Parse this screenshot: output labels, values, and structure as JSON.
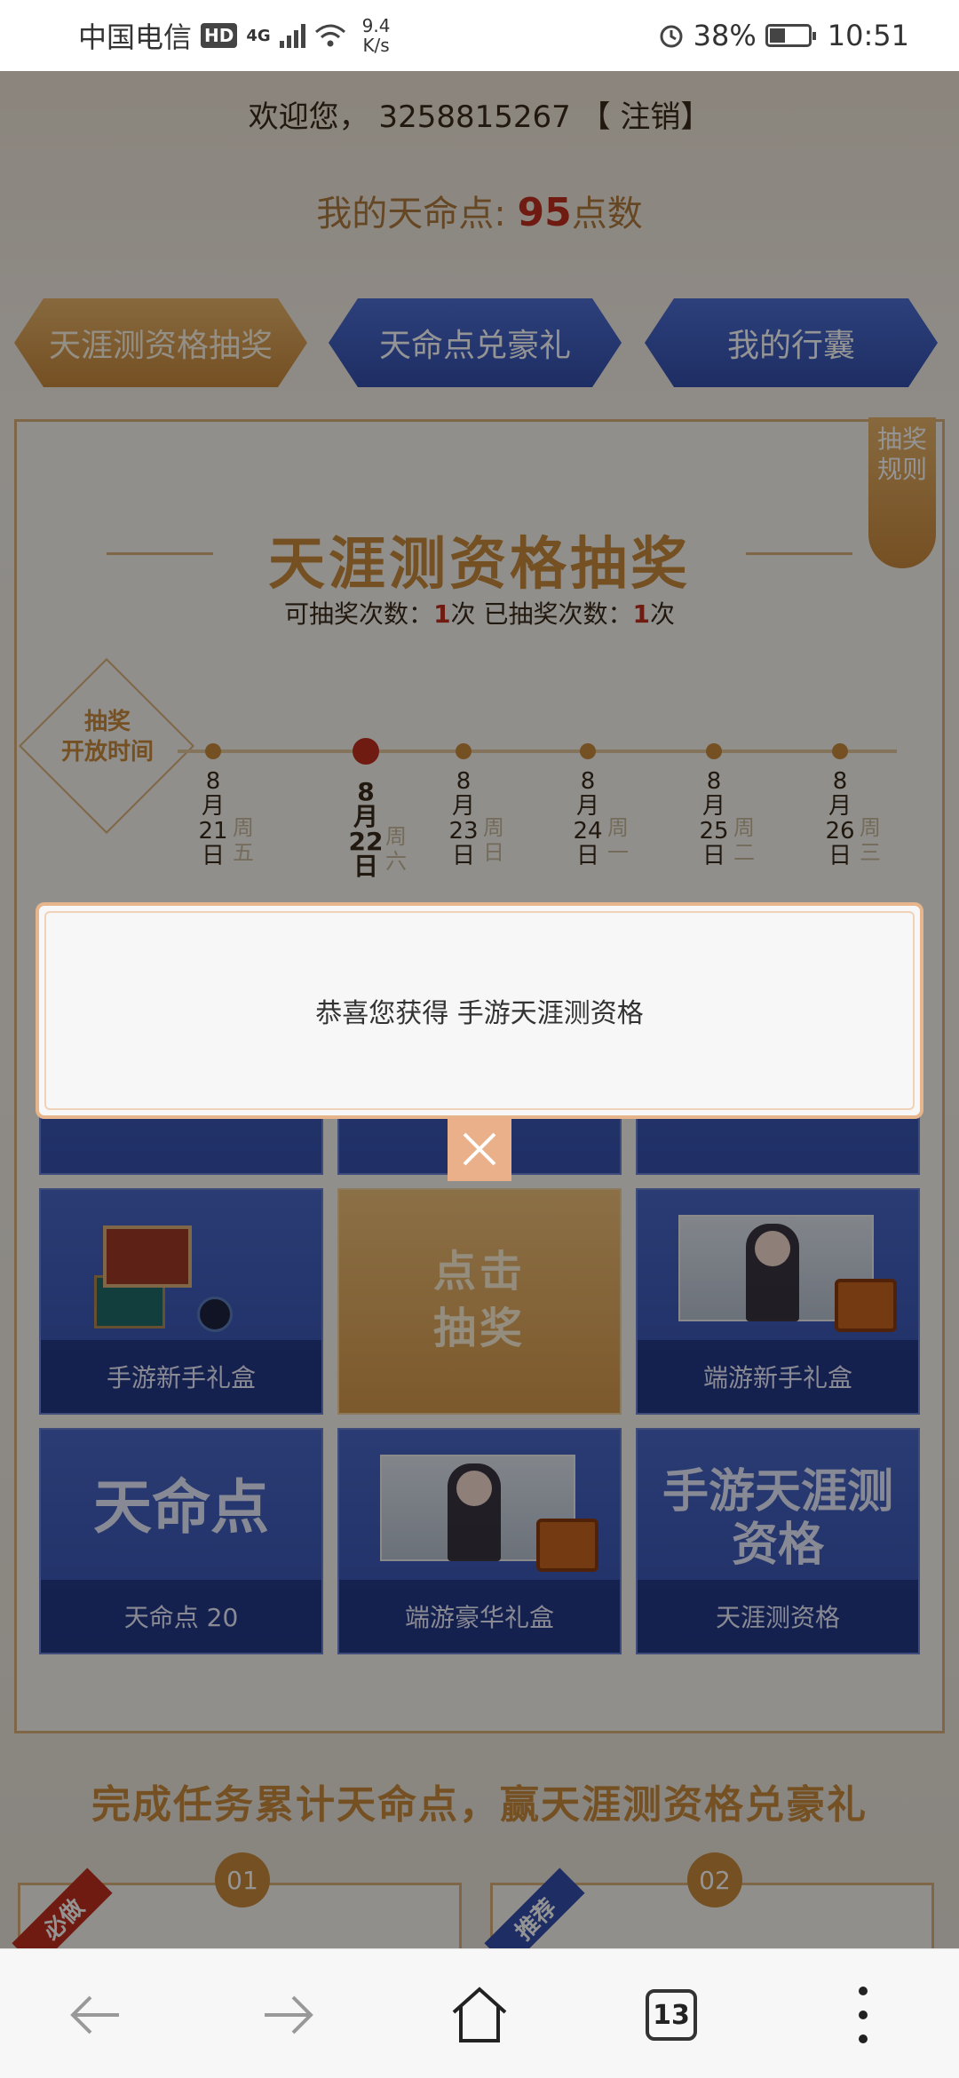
{
  "status_bar": {
    "carrier": "中国电信",
    "hd": "HD",
    "signal": "4G",
    "net_speed_value": "9.4",
    "net_speed_unit": "K/s",
    "battery": "38%",
    "time": "10:51"
  },
  "header": {
    "welcome": "欢迎您， 3258815267 【 注销】",
    "points_prefix": "我的天命点: ",
    "points_value": "95",
    "points_suffix": "点数"
  },
  "tabs": [
    {
      "label": "天涯测资格抽奖"
    },
    {
      "label": "天命点兑豪礼"
    },
    {
      "label": "我的行囊"
    }
  ],
  "rules_label": "抽奖规则",
  "lottery": {
    "title": "天涯测资格抽奖",
    "remaining_label": "可抽奖次数：",
    "remaining_value": "1",
    "remaining_unit": "次 已抽奖次数：",
    "used_value": "1",
    "used_unit": "次",
    "open_time_label_1": "抽奖",
    "open_time_label_2": "开放时间",
    "dates": [
      {
        "month": "8",
        "m": "月",
        "day": "21",
        "d": "日",
        "weekday": "周五"
      },
      {
        "month": "8",
        "m": "月",
        "day": "22",
        "d": "日",
        "weekday": "周六"
      },
      {
        "month": "8",
        "m": "月",
        "day": "23",
        "d": "日",
        "weekday": "周日"
      },
      {
        "month": "8",
        "m": "月",
        "day": "24",
        "d": "日",
        "weekday": "周一"
      },
      {
        "month": "8",
        "m": "月",
        "day": "25",
        "d": "日",
        "weekday": "周二"
      },
      {
        "month": "8",
        "m": "月",
        "day": "26",
        "d": "日",
        "weekday": "周三"
      }
    ]
  },
  "prizes": {
    "gift_box_mobile": "手游新手礼盒",
    "draw_line1": "点击",
    "draw_line2": "抽奖",
    "gift_box_pc": "端游新手礼盒",
    "tianming_big": "天命点",
    "tianming_caption": "天命点 20",
    "luxury_box": "端游豪华礼盒",
    "qual_big_1": "手游天涯测",
    "qual_big_2": "资格",
    "qual_caption": "天涯测资格"
  },
  "tasks": {
    "title": "完成任务累计天命点，赢天涯测资格兑豪礼",
    "step1": "01",
    "step2": "02",
    "ribbon1": "必做",
    "ribbon2": "推荐"
  },
  "dialog": {
    "message": "恭喜您获得 手游天涯测资格"
  },
  "browser": {
    "tab_count": "13"
  }
}
